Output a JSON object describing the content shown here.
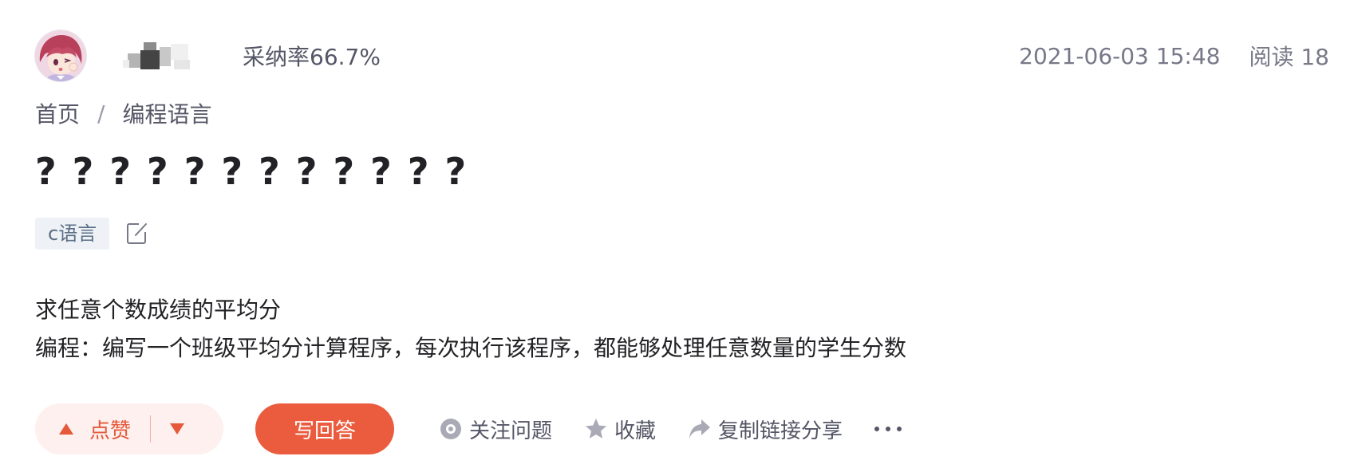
{
  "header": {
    "adoption_rate": "采纳率66.7%",
    "timestamp": "2021-06-03 15:48",
    "read_count": "阅读 18"
  },
  "breadcrumb": {
    "items": [
      "首页",
      "编程语言"
    ],
    "separator": "/"
  },
  "question": {
    "title": "????????????",
    "tag": "c语言",
    "body_lines": [
      "求任意个数成绩的平均分",
      "编程：编写一个班级平均分计算程序，每次执行该程序，都能够处理任意数量的学生分数"
    ]
  },
  "actions": {
    "upvote_label": "点赞",
    "answer_label": "写回答",
    "follow_label": "关注问题",
    "collect_label": "收藏",
    "share_label": "复制链接分享"
  },
  "icons": {
    "upvote": "triangle-up-icon",
    "downvote": "triangle-down-icon",
    "follow": "eye-icon",
    "collect": "star-icon",
    "share": "share-arrow-icon",
    "more": "more-dots-icon",
    "edit": "edit-icon"
  },
  "colors": {
    "accent": "#eb5c3e",
    "vote_bg": "#fdf0ee",
    "tag_bg": "#eef2f6",
    "tag_text": "#5a6e85",
    "muted_text": "#777888"
  }
}
